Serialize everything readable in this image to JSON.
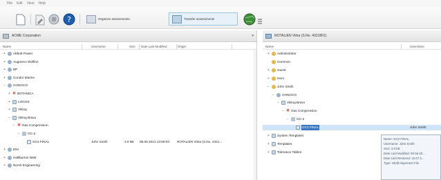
{
  "menu": [
    "File",
    "Edit",
    "View",
    "Help"
  ],
  "toolbar": {
    "btn_organize": "Organize assessments",
    "btn_transfer": "Transfer assessments"
  },
  "left": {
    "title": "ACME Corporation",
    "columns": [
      "Name",
      "Username",
      "Size",
      "Date Last Modified",
      "Origin"
    ],
    "tree": [
      {
        "label": "Abbott Power",
        "depth": 0,
        "icon": "company",
        "exp": "+"
      },
      {
        "label": "Augmeco Wolfine",
        "depth": 0,
        "icon": "company",
        "exp": "+"
      },
      {
        "label": "BP",
        "depth": 0,
        "icon": "company",
        "exp": "+"
      },
      {
        "label": "Condor Marine",
        "depth": 0,
        "icon": "company",
        "exp": "+"
      },
      {
        "label": "CONOCO",
        "depth": 0,
        "icon": "company",
        "exp": "−"
      },
      {
        "label": "BOTANICA",
        "depth": 1,
        "icon": "x",
        "exp": "+"
      },
      {
        "label": "LOGOS",
        "depth": 1,
        "icon": "folder",
        "exp": "+"
      },
      {
        "label": "Viking",
        "depth": 1,
        "icon": "folder",
        "exp": "+"
      },
      {
        "label": "Viking Bravo",
        "depth": 1,
        "icon": "folder",
        "exp": "−"
      },
      {
        "label": "Gas Compression",
        "depth": 2,
        "icon": "x",
        "exp": "−"
      },
      {
        "label": "GC-2",
        "depth": 3,
        "icon": "lock",
        "exp": "−"
      },
      {
        "label": "GC2 FINAL",
        "depth": 4,
        "icon": "doc",
        "exp": "",
        "username": "John Smith",
        "size": "3.9 kB",
        "date": "05.06.2013 13:59:03",
        "origin": "ROTALIEN Viitra (S.No. 4321..."
      },
      {
        "label": "ENI",
        "depth": 0,
        "icon": "company",
        "exp": "+"
      },
      {
        "label": "Halliburton NNE",
        "depth": 0,
        "icon": "company",
        "exp": "+"
      },
      {
        "label": "Norsh Engineering",
        "depth": 0,
        "icon": "company",
        "exp": "+"
      }
    ]
  },
  "right": {
    "title": "ROTALIEN Viitra (S.No. 4321801)",
    "columns": [
      "Name",
      "Username"
    ],
    "tree": [
      {
        "label": "Administrator",
        "depth": 0,
        "icon": "user",
        "exp": "+"
      },
      {
        "label": "Common",
        "depth": 0,
        "icon": "user",
        "exp": ""
      },
      {
        "label": "Guest",
        "depth": 0,
        "icon": "user",
        "exp": "+"
      },
      {
        "label": "Heni",
        "depth": 0,
        "icon": "user",
        "exp": "+"
      },
      {
        "label": "John Smith",
        "depth": 0,
        "icon": "user",
        "exp": "−"
      },
      {
        "label": "CONOCO",
        "depth": 1,
        "icon": "company",
        "exp": "−"
      },
      {
        "label": "Viking Bravo",
        "depth": 2,
        "icon": "folder",
        "exp": "−"
      },
      {
        "label": "Gas Compression",
        "depth": 3,
        "icon": "x",
        "exp": "−"
      },
      {
        "label": "GC-2",
        "depth": 4,
        "icon": "lock",
        "exp": "−"
      },
      {
        "label": "GC2 FINAL",
        "depth": 5,
        "icon": "doc",
        "exp": "",
        "username": "John Smith",
        "selected": true
      },
      {
        "label": "System Templates",
        "depth": 0,
        "icon": "folder",
        "exp": "+"
      },
      {
        "label": "Templates",
        "depth": 0,
        "icon": "folder",
        "exp": "+"
      },
      {
        "label": "Tolerance Tables",
        "depth": 0,
        "icon": "folder",
        "exp": "+"
      }
    ]
  },
  "tooltip": [
    "Name: GC2 FINAL",
    "Username: John Smith",
    "Size: 3.9 kB",
    "Date Last Modified: 05.06.20...",
    "Date Last Restored: 10.07.2...",
    "Type: Shaft Alignment File"
  ],
  "colors": {
    "selected_row": "#cfe4f8",
    "x_icon": "#d0231b",
    "accent": "#3a78c2"
  }
}
